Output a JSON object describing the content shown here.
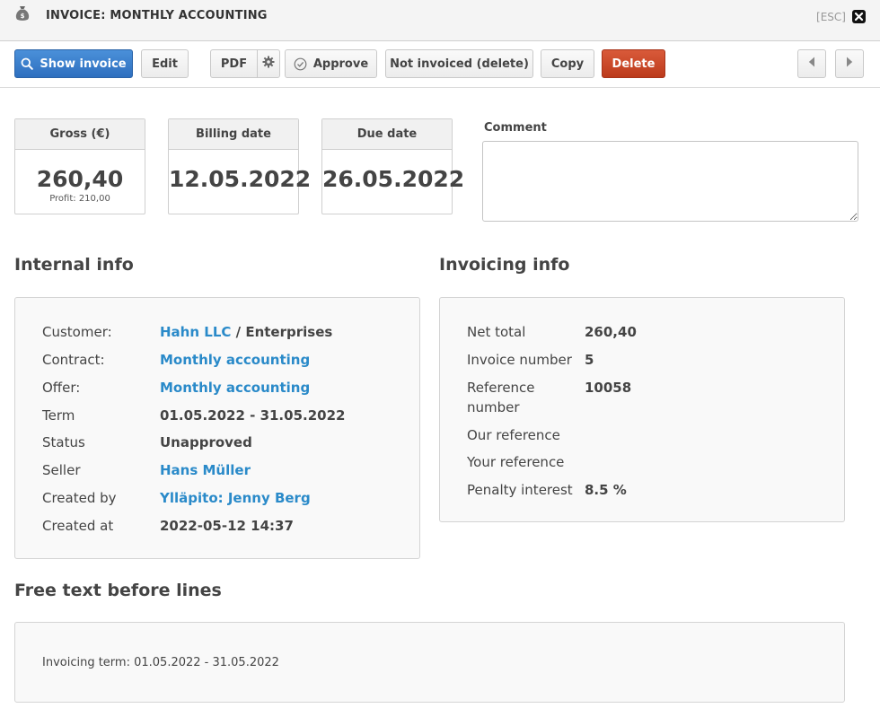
{
  "window": {
    "title": "INVOICE: MONTHLY ACCOUNTING",
    "esc_label": "[ESC]",
    "icon": "money-bag-icon"
  },
  "toolbar": {
    "show_invoice": "Show invoice",
    "edit": "Edit",
    "pdf": "PDF",
    "approve": "Approve",
    "not_invoiced": "Not invoiced (delete)",
    "copy": "Copy",
    "delete": "Delete"
  },
  "stats": {
    "gross": {
      "label": "Gross (€)",
      "value": "260,40",
      "sub": "Profit: 210,00"
    },
    "billing_date": {
      "label": "Billing date",
      "value": "12.05.2022"
    },
    "due_date": {
      "label": "Due date",
      "value": "26.05.2022"
    }
  },
  "comment": {
    "label": "Comment",
    "value": ""
  },
  "internal_info": {
    "title": "Internal info",
    "customer": {
      "label": "Customer:",
      "name": "Hahn LLC",
      "separator": " / ",
      "group": "Enterprises"
    },
    "contract": {
      "label": "Contract:",
      "value": "Monthly accounting"
    },
    "offer": {
      "label": "Offer:",
      "value": "Monthly accounting"
    },
    "term": {
      "label": "Term",
      "value": "01.05.2022 - 31.05.2022"
    },
    "status": {
      "label": "Status",
      "value": "Unapproved"
    },
    "seller": {
      "label": "Seller",
      "value": "Hans Müller"
    },
    "created_by": {
      "label": "Created by",
      "value": "Ylläpito: Jenny Berg"
    },
    "created_at": {
      "label": "Created at",
      "value": "2022-05-12 14:37"
    }
  },
  "invoicing_info": {
    "title": "Invoicing info",
    "net_total": {
      "label": "Net total",
      "value": "260,40"
    },
    "invoice_number": {
      "label": "Invoice number",
      "value": "5"
    },
    "reference_number": {
      "label_line1": "Reference",
      "label_line2": "number",
      "value": "10058"
    },
    "our_reference": {
      "label": "Our reference",
      "value": ""
    },
    "your_reference": {
      "label": "Your reference",
      "value": ""
    },
    "penalty_interest": {
      "label": "Penalty interest",
      "value": "8.5 %"
    }
  },
  "free_text": {
    "title": "Free text before lines",
    "value": "Invoicing term: 01.05.2022 - 31.05.2022"
  },
  "colors": {
    "primary": "#2e6fbf",
    "danger": "#bc3a1c",
    "link": "#2a8ac9"
  }
}
